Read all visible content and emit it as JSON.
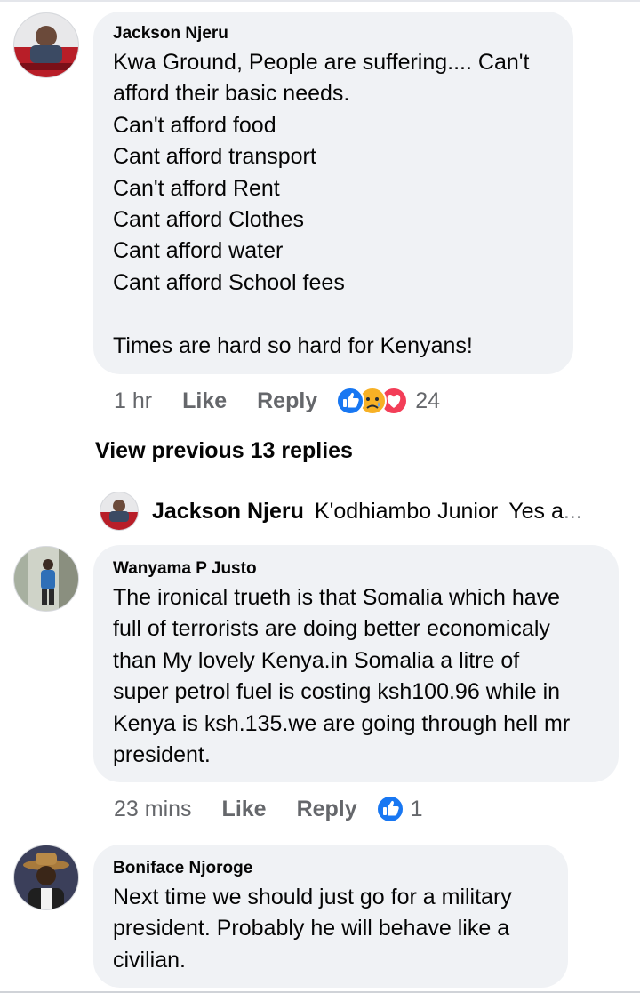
{
  "comments": [
    {
      "author": "Jackson Njeru",
      "lines": [
        "Kwa Ground, People are suffering.... Can't",
        "afford their basic needs.",
        "Can't afford food",
        "Cant afford transport",
        "Can't afford Rent",
        "Cant afford Clothes",
        "Cant afford water",
        "Cant afford School fees",
        "",
        "Times are hard so hard for Kenyans!"
      ],
      "time": "1 hr",
      "like_label": "Like",
      "reply_label": "Reply",
      "reaction_icons": [
        "like-icon",
        "sad-icon",
        "love-icon"
      ],
      "reaction_count": "24"
    },
    {
      "author": "Wanyama P Justo",
      "lines": [
        "The ironical trueth is that Somalia which have",
        "full of terrorists are doing better economicaly",
        "than My lovely Kenya.in Somalia a litre of",
        "super petrol fuel is costing ksh100.96 while in",
        "Kenya is ksh.135.we are going through hell mr",
        "president."
      ],
      "time": "23 mins",
      "like_label": "Like",
      "reply_label": "Reply",
      "reaction_icons": [
        "like-icon"
      ],
      "reaction_count": "1"
    },
    {
      "author": "Boniface Njoroge",
      "lines": [
        "Next time we should just go for a military",
        "president. Probably he will behave like a",
        "civilian."
      ]
    }
  ],
  "view_previous": "View previous 13 replies",
  "reply_preview": {
    "author": "Jackson Njeru",
    "mention": "K'odhiambo Junior",
    "text": "Yes a",
    "ellipsis": "..."
  },
  "colors": {
    "bubble": "#f0f2f5",
    "meta": "#65676b",
    "like_blue": "#1877f2",
    "love_red": "#f33e58",
    "sad_yellow": "#f7b125"
  }
}
